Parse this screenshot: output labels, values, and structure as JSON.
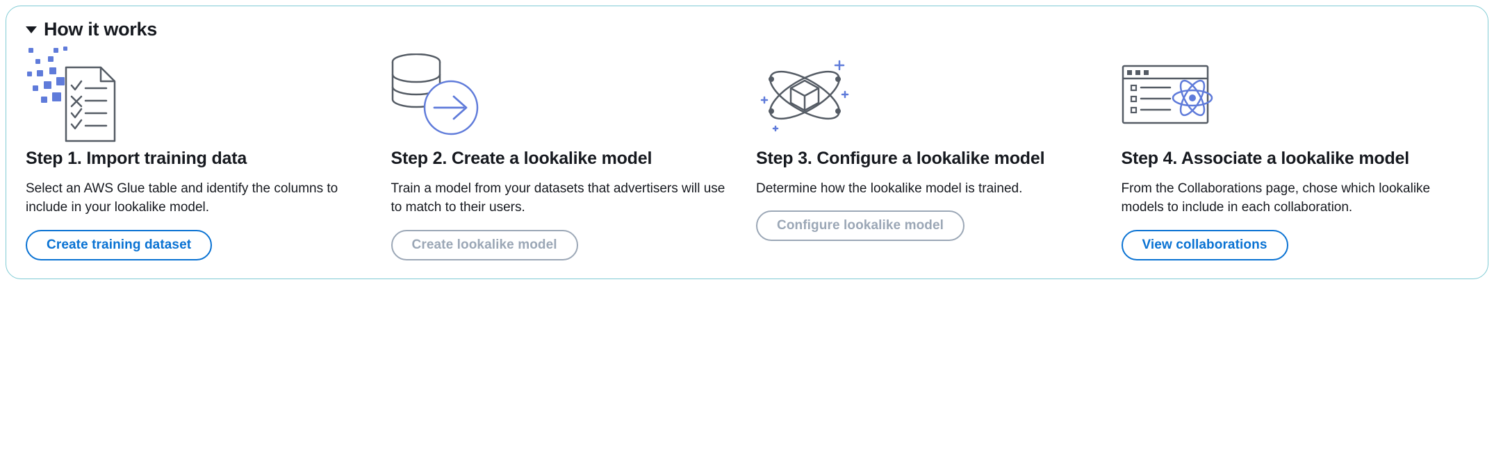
{
  "section_title": "How it works",
  "steps": [
    {
      "title": "Step 1. Import training data",
      "desc": "Select an AWS Glue table and identify the columns to include in your lookalike model.",
      "button_label": "Create training dataset",
      "button_enabled": true
    },
    {
      "title": "Step 2. Create a lookalike model",
      "desc": "Train a model from your datasets that advertisers will use to match to their users.",
      "button_label": "Create lookalike model",
      "button_enabled": false
    },
    {
      "title": "Step 3. Configure a lookalike model",
      "desc": "Determine how the lookalike model is trained.",
      "button_label": "Configure lookalike model",
      "button_enabled": false
    },
    {
      "title": "Step 4. Associate a lookalike model",
      "desc": "From the Collaborations page, chose which lookalike models to include in each collaboration.",
      "button_label": "View collaborations",
      "button_enabled": true
    }
  ]
}
